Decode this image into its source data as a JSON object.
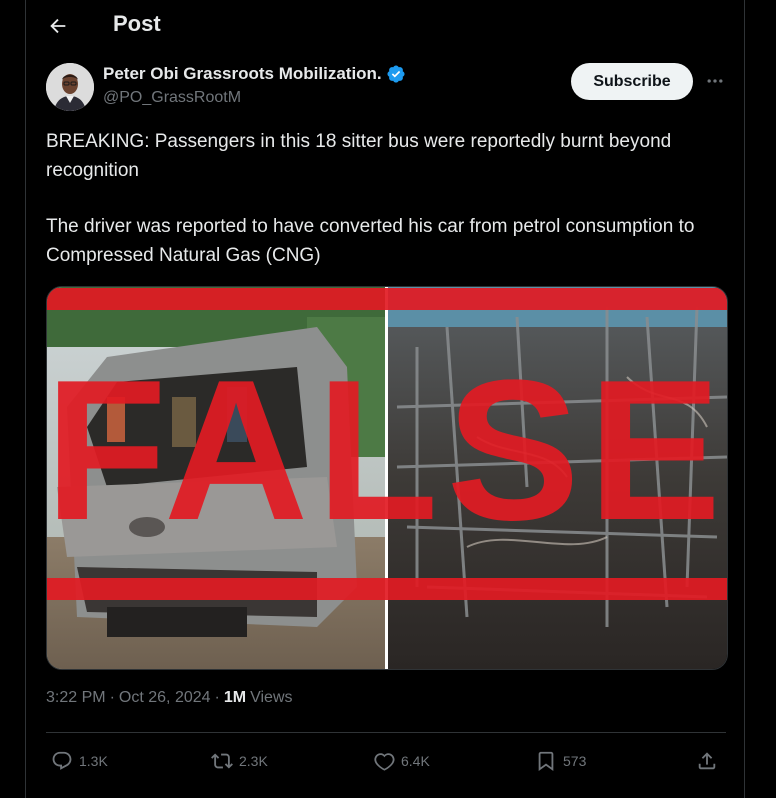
{
  "header": {
    "title": "Post"
  },
  "author": {
    "name": "Peter Obi Grassroots Mobilization.",
    "handle": "@PO_GrassRootM",
    "verified": true,
    "verified_color": "#1d9bf0"
  },
  "subscribe_label": "Subscribe",
  "post": {
    "paragraphs": [
      "BREAKING: Passengers in this 18 sitter bus were reportedly burnt beyond recognition",
      "The driver was reported to have converted his car from petrol consumption to Compressed Natural Gas (CNG)"
    ]
  },
  "media": {
    "stamp_text": "FALSE",
    "stamp_color": "#e21b23"
  },
  "meta": {
    "time": "3:22 PM",
    "separator": "·",
    "date": "Oct 26, 2024",
    "views_count": "1M",
    "views_label": "Views"
  },
  "actions": {
    "replies": "1.3K",
    "reposts": "2.3K",
    "likes": "6.4K",
    "bookmarks": "573"
  },
  "icons": {
    "back": "arrow-left-icon",
    "more": "more-horizontal-icon",
    "verified": "verified-badge-icon",
    "reply": "reply-icon",
    "repost": "repost-icon",
    "like": "heart-icon",
    "bookmark": "bookmark-icon",
    "share": "share-icon"
  }
}
